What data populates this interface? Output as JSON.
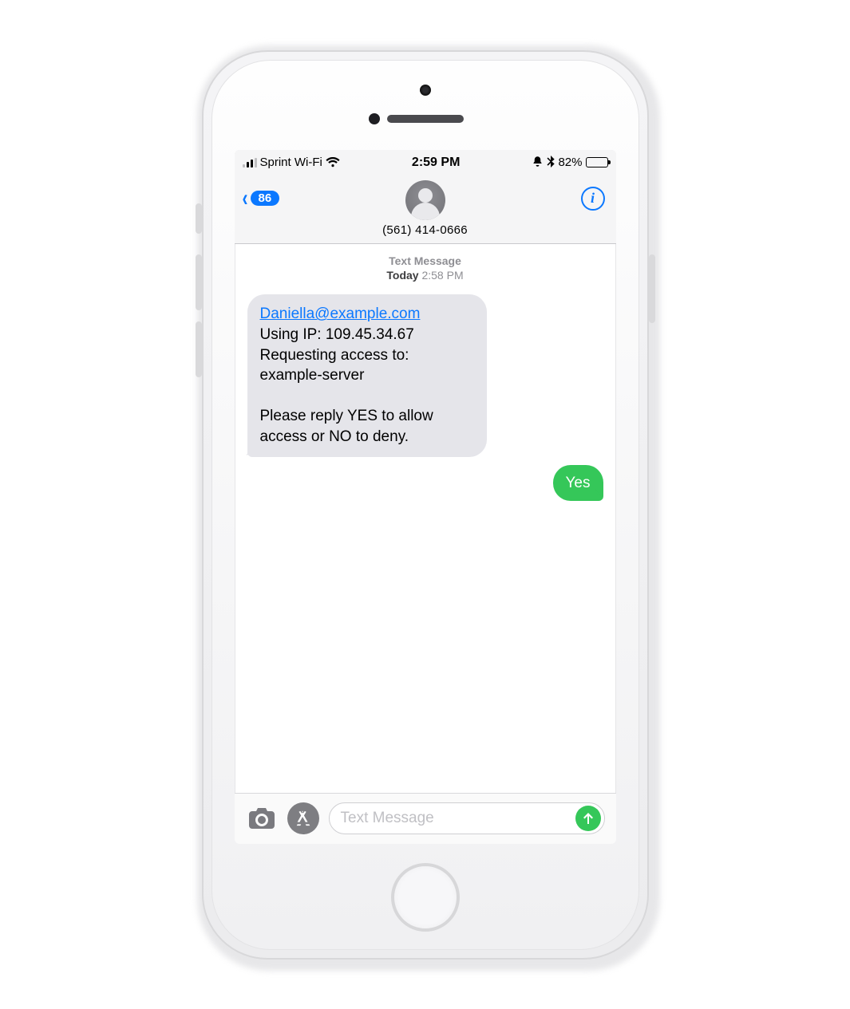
{
  "statusbar": {
    "carrier": "Sprint Wi-Fi",
    "time": "2:59 PM",
    "battery_pct": "82%",
    "battery_fill": 82
  },
  "nav": {
    "back_count": "86",
    "contact_number": "(561) 414-0666"
  },
  "thread": {
    "meta_label": "Text Message",
    "meta_day": "Today",
    "meta_time": "2:58 PM",
    "incoming": {
      "email": "Daniella@example.com",
      "line_ip": "Using IP: 109.45.34.67",
      "line_req1": "Requesting access to:",
      "line_req2": "example-server",
      "line_instr": "Please reply YES to allow access or NO to deny."
    },
    "outgoing": "Yes"
  },
  "compose": {
    "placeholder": "Text Message"
  }
}
